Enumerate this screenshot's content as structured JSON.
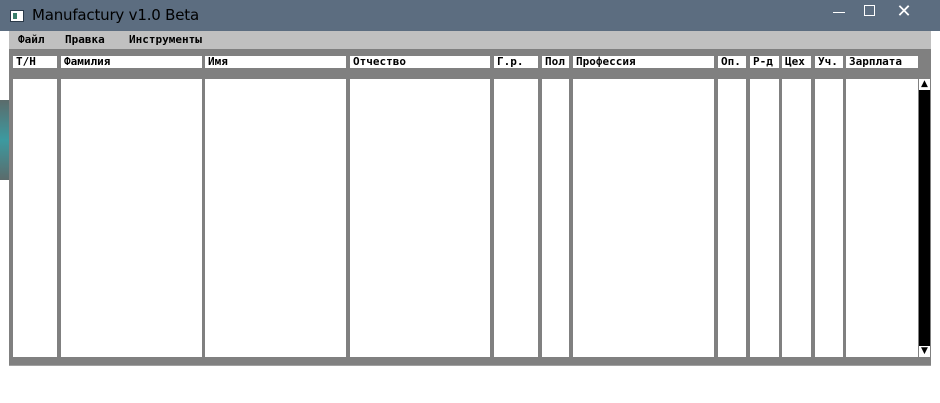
{
  "window": {
    "title": "Manufactury v1.0 Beta",
    "controls": {
      "minimize": "—",
      "maximize": "☐",
      "close": "✕"
    }
  },
  "menu": [
    "Файл",
    "Правка",
    "Инструменты"
  ],
  "table": {
    "columns": [
      "Т/Н",
      "Фамилия",
      "Имя",
      "Отчество",
      "Г.р.",
      "Пол",
      "Профессия",
      "Оп.",
      "Р-д",
      "Цех",
      "Уч.",
      "Зарплата"
    ],
    "rows": []
  },
  "scrollbar": {
    "up": "▲",
    "down": "▼"
  },
  "colors": {
    "titlebar": "#5c6d80",
    "menubar": "#c0c0c0",
    "client": "#808080",
    "cell": "#ffffff"
  }
}
